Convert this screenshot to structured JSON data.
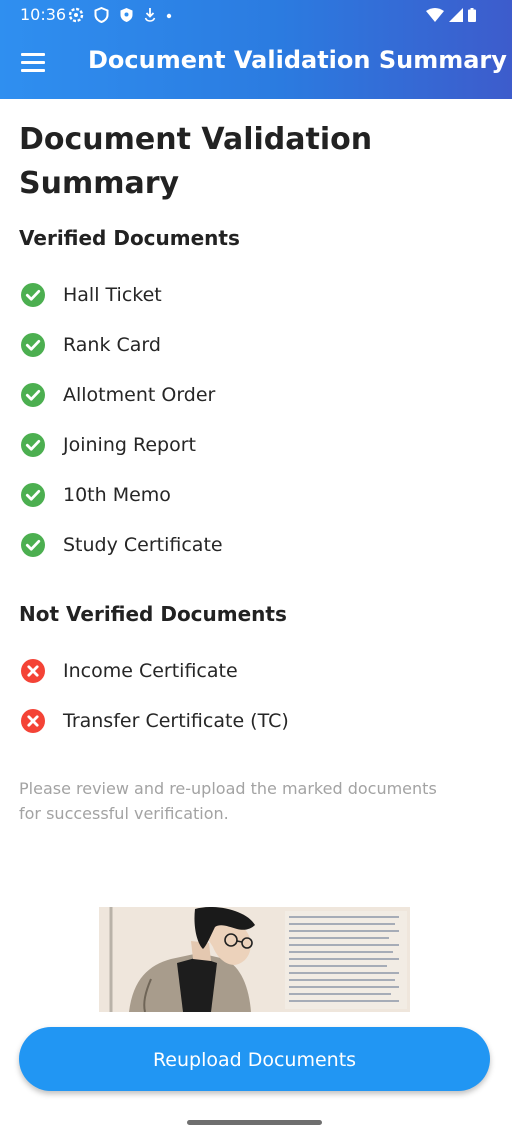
{
  "status_bar": {
    "time": "10:36"
  },
  "app_bar": {
    "title": "Document Validation Summary"
  },
  "page": {
    "title": "Document Validation Summary"
  },
  "verified": {
    "heading": "Verified Documents",
    "items": [
      {
        "label": "Hall Ticket"
      },
      {
        "label": "Rank Card"
      },
      {
        "label": "Allotment Order"
      },
      {
        "label": "Joining Report"
      },
      {
        "label": "10th Memo"
      },
      {
        "label": "Study Certificate"
      }
    ]
  },
  "not_verified": {
    "heading": "Not Verified Documents",
    "items": [
      {
        "label": "Income Certificate"
      },
      {
        "label": "Transfer Certificate (TC)"
      }
    ]
  },
  "note": "Please review and re-upload the marked documents for successful verification.",
  "button": {
    "label": "Reupload Documents"
  },
  "colors": {
    "app_bar_start": "#2f8ff0",
    "app_bar_end": "#3d5ccc",
    "verified_icon": "#4caf50",
    "error_icon": "#f44336",
    "button": "#2196f3"
  },
  "icons": {
    "verified": "check-circle-icon",
    "not_verified": "cross-circle-icon"
  }
}
